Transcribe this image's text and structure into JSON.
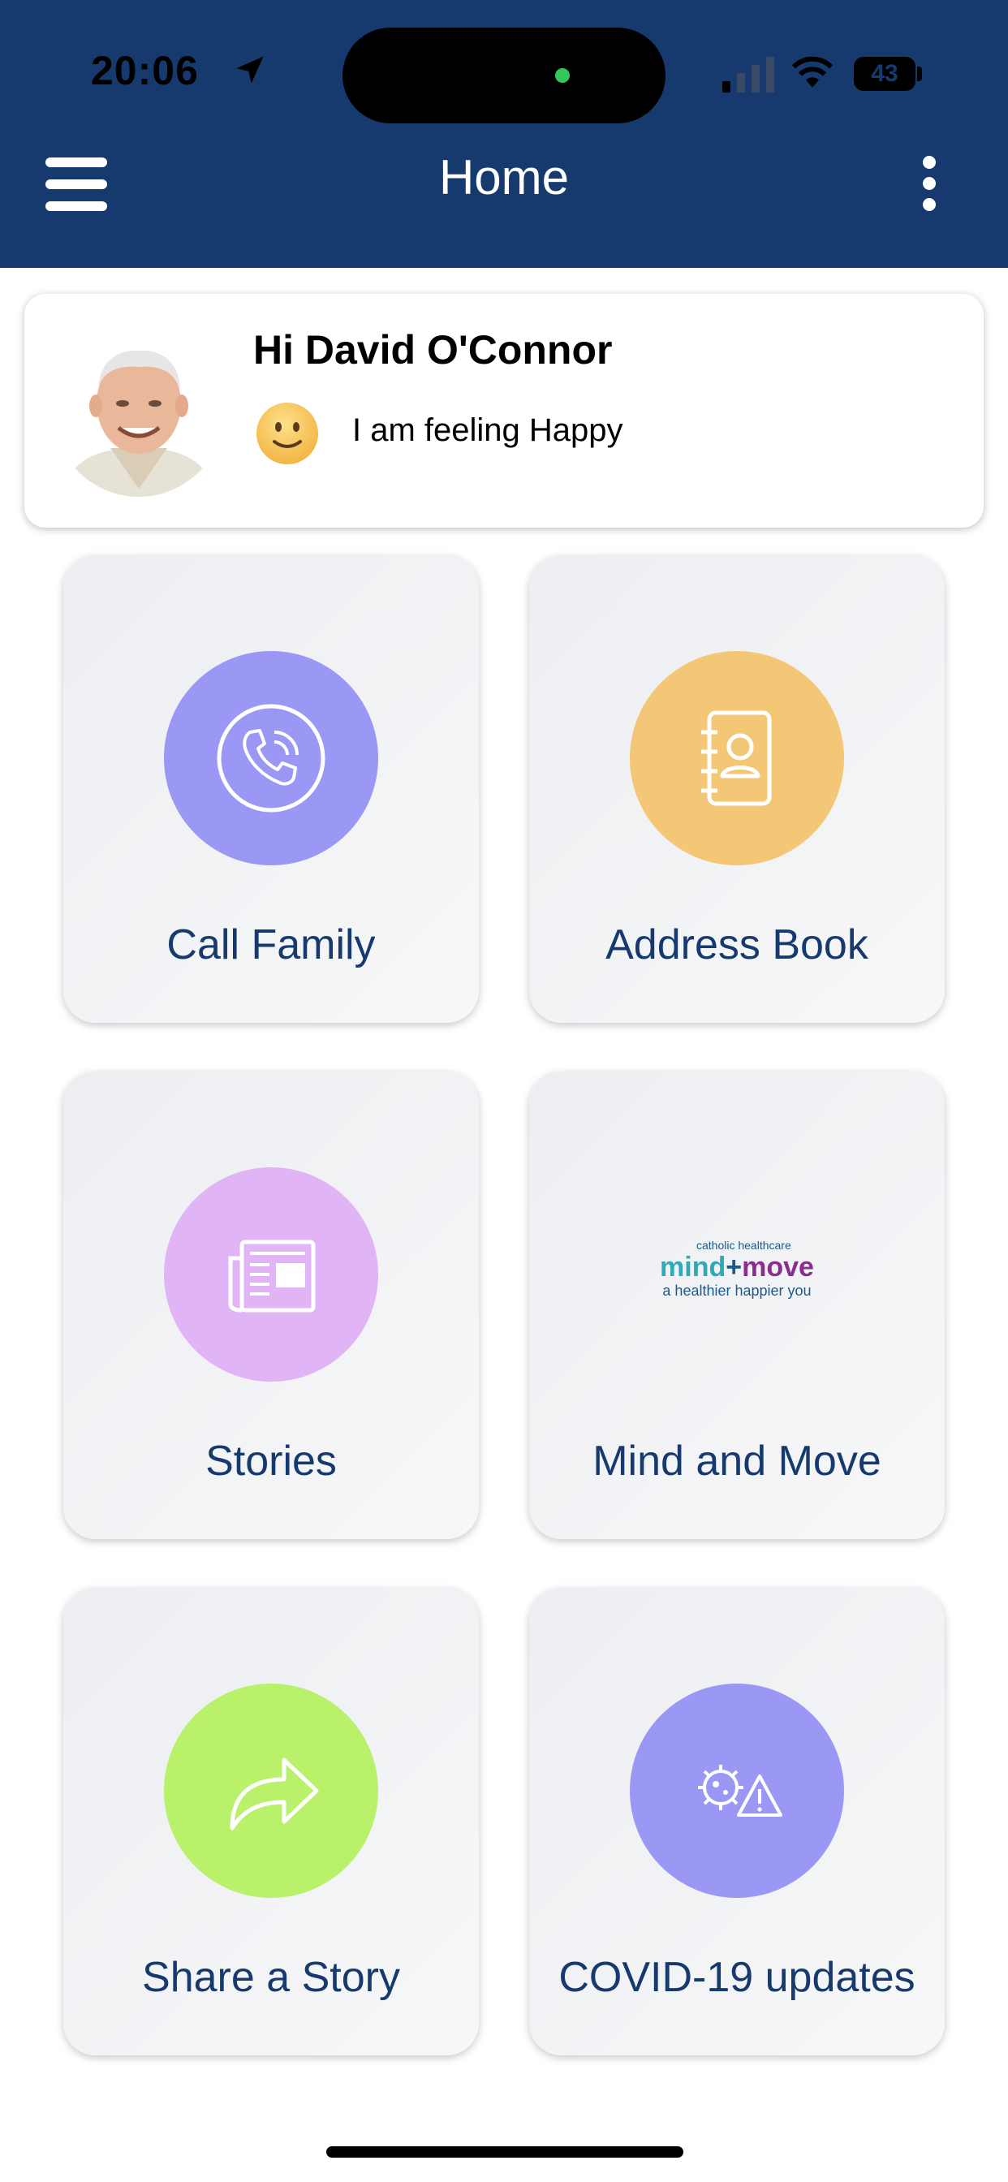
{
  "status_bar": {
    "time": "20:06",
    "battery": "43"
  },
  "header": {
    "title": "Home",
    "menu_icon": "hamburger-menu-icon",
    "more_icon": "vertical-ellipsis-icon",
    "background_color": "#173a6e"
  },
  "profile": {
    "greeting": "Hi David O'Connor",
    "mood_emoji": "slightly-smiling-face",
    "mood_text": "I am feeling Happy"
  },
  "tiles": [
    {
      "label": "Call Family",
      "icon": "phone-call-icon",
      "color": "#9b97f5"
    },
    {
      "label": "Address Book",
      "icon": "address-book-icon",
      "color": "#f3c775"
    },
    {
      "label": "Stories",
      "icon": "newspaper-icon",
      "color": "#e1b4f5"
    },
    {
      "label": "Mind and Move",
      "icon": "mind-move-logo",
      "logo": {
        "top": "catholic healthcare",
        "mind": "mind",
        "plus": "+",
        "move": "move",
        "sub": "a healthier happier you"
      }
    },
    {
      "label": "Share a Story",
      "icon": "share-arrow-icon",
      "color": "#b9f16b"
    },
    {
      "label": "COVID-19 updates",
      "icon": "virus-warning-icon",
      "color": "#9b97f5"
    }
  ]
}
